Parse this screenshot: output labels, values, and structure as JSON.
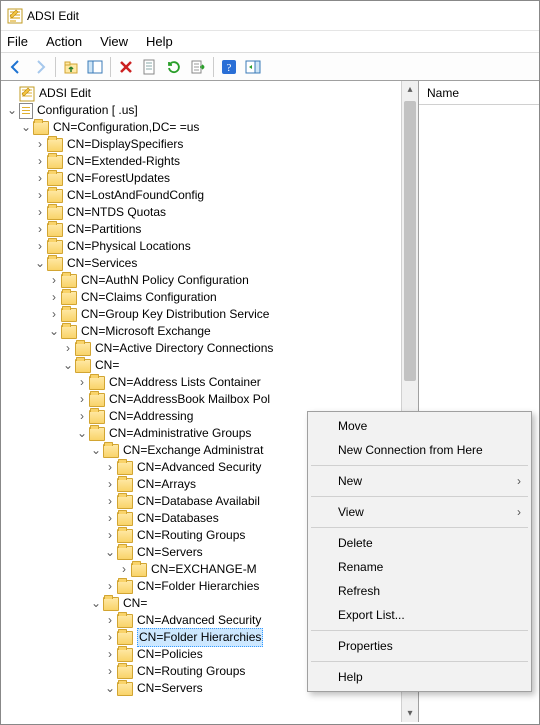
{
  "window": {
    "title": "ADSI Edit"
  },
  "menubar": [
    "File",
    "Action",
    "View",
    "Help"
  ],
  "list_pane": {
    "header_name": "Name"
  },
  "tree": {
    "root_label": "ADSI Edit",
    "config_label": "Configuration [                                 .us]",
    "config_dn_label": "CN=Configuration,DC=                             =us",
    "items_level1": [
      "CN=DisplaySpecifiers",
      "CN=Extended-Rights",
      "CN=ForestUpdates",
      "CN=LostAndFoundConfig",
      "CN=NTDS Quotas",
      "CN=Partitions",
      "CN=Physical Locations"
    ],
    "services_label": "CN=Services",
    "services_children": [
      "CN=AuthN Policy Configuration",
      "CN=Claims Configuration",
      "CN=Group Key Distribution Service"
    ],
    "msexchange_label": "CN=Microsoft Exchange",
    "msx_children": [
      "CN=Active Directory Connections"
    ],
    "cn_blank1_label": "CN=       ",
    "cn_blank1_children": [
      "CN=Address Lists Container",
      "CN=AddressBook Mailbox Pol",
      "CN=Addressing"
    ],
    "admin_groups_label": "CN=Administrative Groups",
    "exch_admin_label": "CN=Exchange Administrat",
    "exch_admin_children": [
      "CN=Advanced Security",
      "CN=Arrays",
      "CN=Database Availabil",
      "CN=Databases",
      "CN=Routing Groups"
    ],
    "servers1_label": "CN=Servers",
    "exchange_m_label": "CN=EXCHANGE-M",
    "folder_hier1_label": "CN=Folder Hierarchies",
    "cn_blank2_label": "CN=",
    "cn_blank2_children_pre": [
      "CN=Advanced Security"
    ],
    "folder_hier2_label": "CN=Folder Hierarchies",
    "cn_blank2_children_post": [
      "CN=Policies",
      "CN=Routing Groups"
    ],
    "servers2_label": "CN=Servers"
  },
  "context_menu": {
    "move": "Move",
    "new_conn": "New Connection from Here",
    "new": "New",
    "view": "View",
    "delete": "Delete",
    "rename": "Rename",
    "refresh": "Refresh",
    "export": "Export List...",
    "properties": "Properties",
    "help": "Help"
  }
}
